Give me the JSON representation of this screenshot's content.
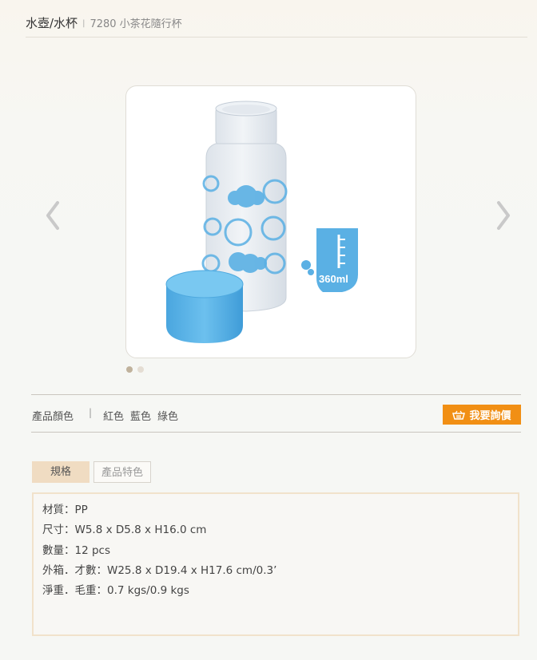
{
  "breadcrumb": {
    "category": "水壺/水杯",
    "separator": "|",
    "product": "7280 小茶花隨行杯"
  },
  "gallery": {
    "capacity_label": "360ml",
    "slide_count": 2,
    "active_slide": 1,
    "colors": {
      "bottle_blue": "#5ab0e4",
      "cap_blue": "#5ab3e6"
    }
  },
  "colors": {
    "label": "產品顏色",
    "separator": "|",
    "options": [
      "紅色",
      "藍色",
      "綠色"
    ]
  },
  "inquiry_button": {
    "label": "我要詢價",
    "icon": "basket-icon",
    "color": "#f18f14"
  },
  "tabs": {
    "spec_label": "規格",
    "features_label": "產品特色"
  },
  "specs": [
    "材質：PP",
    "尺寸：W5.8 x D5.8 x H16.0 cm",
    "數量：12 pcs",
    "外箱．才數：W25.8 x D19.4 x H17.6 cm/0.3’",
    "淨重．毛重：0.7 kgs/0.9 kgs"
  ]
}
